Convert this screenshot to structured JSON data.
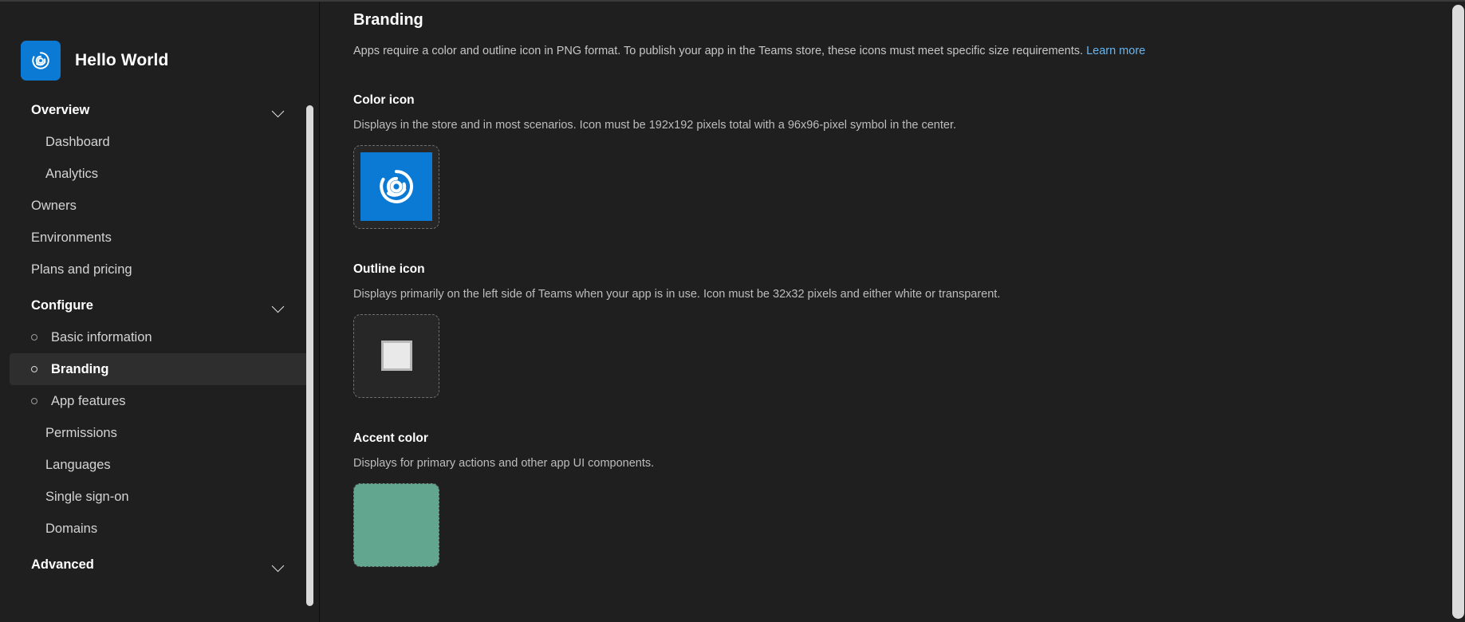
{
  "brand": {
    "name": "Hello World",
    "logo_icon": "spiral-swirl-icon",
    "logo_bg_color": "#0b7ad4"
  },
  "sidebar": {
    "groups": [
      {
        "label": "Overview",
        "expanded": true,
        "chevron_icon": "chevron-down-icon",
        "items": [
          {
            "label": "Dashboard",
            "bullet": false,
            "indent": true,
            "selected": false
          },
          {
            "label": "Analytics",
            "bullet": false,
            "indent": true,
            "selected": false
          }
        ]
      }
    ],
    "top_items": [
      {
        "label": "Owners",
        "bullet": false,
        "indent": false,
        "selected": false
      },
      {
        "label": "Environments",
        "bullet": false,
        "indent": false,
        "selected": false
      },
      {
        "label": "Plans and pricing",
        "bullet": false,
        "indent": false,
        "selected": false
      }
    ],
    "configure": {
      "label": "Configure",
      "expanded": true,
      "chevron_icon": "chevron-down-icon",
      "items": [
        {
          "label": "Basic information",
          "bullet": true,
          "indent": false,
          "selected": false
        },
        {
          "label": "Branding",
          "bullet": true,
          "indent": false,
          "selected": true
        },
        {
          "label": "App features",
          "bullet": true,
          "indent": false,
          "selected": false
        },
        {
          "label": "Permissions",
          "bullet": false,
          "indent": true,
          "selected": false
        },
        {
          "label": "Languages",
          "bullet": false,
          "indent": true,
          "selected": false
        },
        {
          "label": "Single sign-on",
          "bullet": false,
          "indent": true,
          "selected": false
        },
        {
          "label": "Domains",
          "bullet": false,
          "indent": true,
          "selected": false
        }
      ]
    },
    "advanced": {
      "label": "Advanced",
      "expanded": false,
      "chevron_icon": "chevron-down-icon"
    }
  },
  "main": {
    "title": "Branding",
    "description": "Apps require a color and outline icon in PNG format. To publish your app in the Teams store, these icons must meet specific size requirements.",
    "learn_more_label": "Learn more",
    "sections": {
      "color_icon": {
        "title": "Color icon",
        "description": "Displays in the store and in most scenarios. Icon must be 192x192 pixels total with a 96x96-pixel symbol in the center.",
        "icon_name": "spiral-swirl-icon",
        "tile_color": "#0b7ad4"
      },
      "outline_icon": {
        "title": "Outline icon",
        "description": "Displays primarily on the left side of Teams when your app is in use. Icon must be 32x32 pixels and either white or transparent.",
        "icon_name": "white-square-outline-icon",
        "tile_color": "#e9e9e9"
      },
      "accent_color": {
        "title": "Accent color",
        "description": "Displays for primary actions and other app UI components.",
        "swatch_color": "#63a68f"
      }
    }
  }
}
